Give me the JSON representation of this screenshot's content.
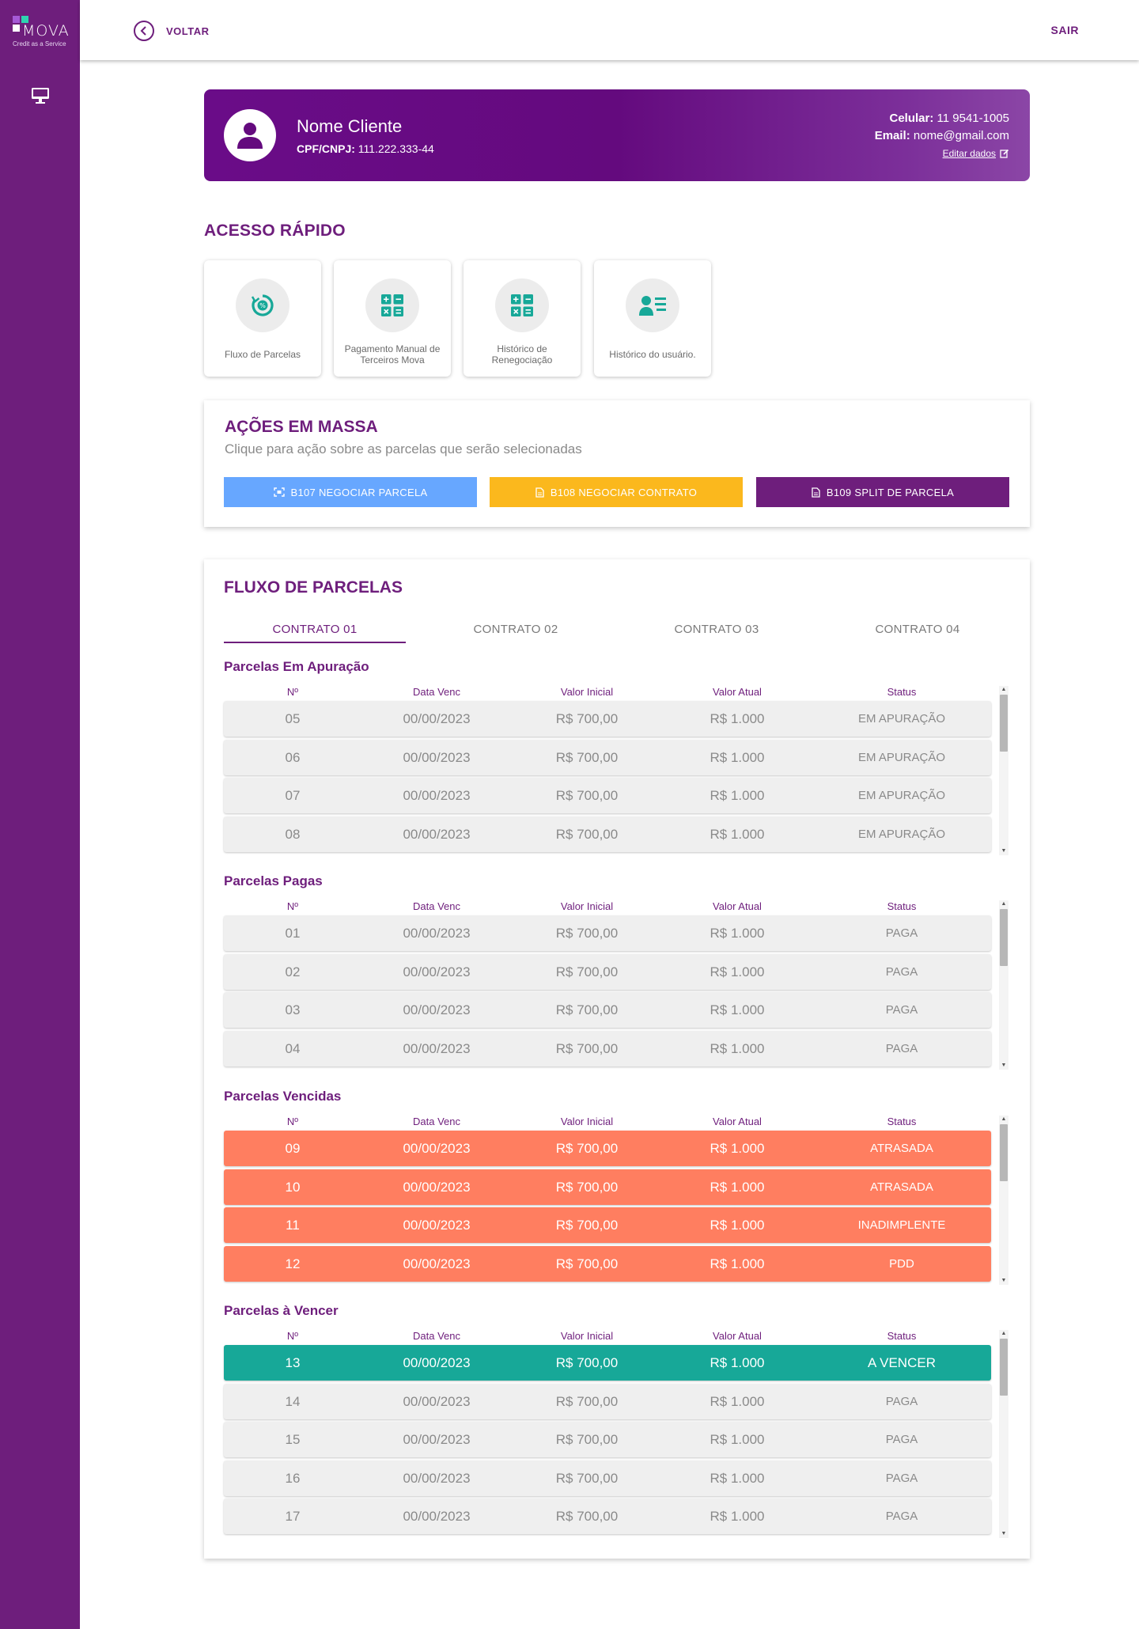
{
  "app": {
    "logo_text": "MOVA",
    "logo_tagline": "Credit as a Service"
  },
  "topbar": {
    "back_label": "VOLTAR",
    "logout_label": "SAIR"
  },
  "client": {
    "name": "Nome Cliente",
    "doc_label": "CPF/CNPJ:",
    "doc_value": "111.222.333-44",
    "phone_label": "Celular:",
    "phone_value": "11 9541-1005",
    "email_label": "Email:",
    "email_value": "nome@gmail.com",
    "edit_label": "Editar dados"
  },
  "quick_access": {
    "title": "ACESSO RÁPIDO",
    "cards": [
      {
        "label": "Fluxo de Parcelas",
        "icon": "percent-cycle-icon"
      },
      {
        "label": "Pagamento Manual de Terceiros Mova",
        "icon": "calculator-icon"
      },
      {
        "label": "Histórico de Renegociação",
        "icon": "calculator-icon"
      },
      {
        "label": "Histórico do usuário.",
        "icon": "user-list-icon"
      }
    ]
  },
  "mass_actions": {
    "title": "AÇÕES EM MASSA",
    "subtitle": "Clique para ação sobre as parcelas que serão selecionadas",
    "buttons": [
      {
        "label": "B107 NEGOCIAR PARCELA",
        "color": "#67a7ff"
      },
      {
        "label": "B108 NEGOCIAR CONTRATO",
        "color": "#fbb81d"
      },
      {
        "label": "B109 SPLIT DE PARCELA",
        "color": "#6e1e7c"
      }
    ]
  },
  "flow": {
    "title": "FLUXO DE PARCELAS",
    "tabs": [
      "CONTRATO 01",
      "CONTRATO 02",
      "CONTRATO 03",
      "CONTRATO 04"
    ],
    "active_tab": "CONTRATO 01",
    "columns": [
      "Nº",
      "Data Venc",
      "Valor Inicial",
      "Valor Atual",
      "Status"
    ],
    "groups": [
      {
        "title": "Parcelas Em Apuração",
        "rows": [
          {
            "n": "05",
            "date": "00/00/2023",
            "initial": "R$ 700,00",
            "current": "R$ 1.000",
            "status": "EM APURAÇÃO"
          },
          {
            "n": "06",
            "date": "00/00/2023",
            "initial": "R$ 700,00",
            "current": "R$ 1.000",
            "status": "EM APURAÇÃO"
          },
          {
            "n": "07",
            "date": "00/00/2023",
            "initial": "R$ 700,00",
            "current": "R$ 1.000",
            "status": "EM APURAÇÃO"
          },
          {
            "n": "08",
            "date": "00/00/2023",
            "initial": "R$ 700,00",
            "current": "R$ 1.000",
            "status": "EM APURAÇÃO"
          }
        ]
      },
      {
        "title": "Parcelas Pagas",
        "rows": [
          {
            "n": "01",
            "date": "00/00/2023",
            "initial": "R$ 700,00",
            "current": "R$ 1.000",
            "status": "PAGA"
          },
          {
            "n": "02",
            "date": "00/00/2023",
            "initial": "R$ 700,00",
            "current": "R$ 1.000",
            "status": "PAGA"
          },
          {
            "n": "03",
            "date": "00/00/2023",
            "initial": "R$ 700,00",
            "current": "R$ 1.000",
            "status": "PAGA"
          },
          {
            "n": "04",
            "date": "00/00/2023",
            "initial": "R$ 700,00",
            "current": "R$ 1.000",
            "status": "PAGA"
          }
        ]
      },
      {
        "title": "Parcelas Vencidas",
        "rows": [
          {
            "n": "09",
            "date": "00/00/2023",
            "initial": "R$ 700,00",
            "current": "R$ 1.000",
            "status": "ATRASADA"
          },
          {
            "n": "10",
            "date": "00/00/2023",
            "initial": "R$ 700,00",
            "current": "R$ 1.000",
            "status": "ATRASADA"
          },
          {
            "n": "11",
            "date": "00/00/2023",
            "initial": "R$ 700,00",
            "current": "R$ 1.000",
            "status": "INADIMPLENTE"
          },
          {
            "n": "12",
            "date": "00/00/2023",
            "initial": "R$ 700,00",
            "current": "R$ 1.000",
            "status": "PDD"
          }
        ]
      },
      {
        "title": "Parcelas à Vencer",
        "rows": [
          {
            "n": "13",
            "date": "00/00/2023",
            "initial": "R$ 700,00",
            "current": "R$ 1.000",
            "status": "A VENCER"
          },
          {
            "n": "14",
            "date": "00/00/2023",
            "initial": "R$ 700,00",
            "current": "R$ 1.000",
            "status": "PAGA"
          },
          {
            "n": "15",
            "date": "00/00/2023",
            "initial": "R$ 700,00",
            "current": "R$ 1.000",
            "status": "PAGA"
          },
          {
            "n": "16",
            "date": "00/00/2023",
            "initial": "R$ 700,00",
            "current": "R$ 1.000",
            "status": "PAGA"
          },
          {
            "n": "17",
            "date": "00/00/2023",
            "initial": "R$ 700,00",
            "current": "R$ 1.000",
            "status": "PAGA"
          }
        ]
      }
    ]
  },
  "colors": {
    "brand_purple": "#6e1e7c",
    "late_row": "#ff7e60",
    "due_row": "#17a898",
    "teal_icon": "#17a898"
  }
}
